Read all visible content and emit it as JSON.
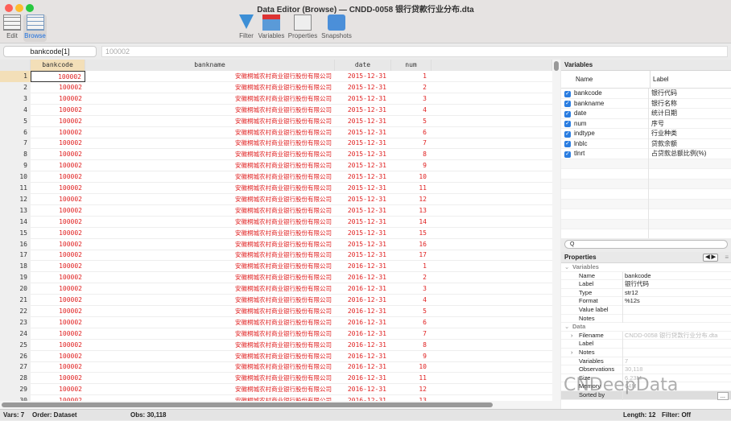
{
  "window": {
    "title": "Data Editor (Browse) — CNDD-0058 银行贷款行业分布.dta"
  },
  "toolbar": {
    "edit": "Edit",
    "browse": "Browse",
    "filter": "Filter",
    "variables": "Variables",
    "properties": "Properties",
    "snapshots": "Snapshots"
  },
  "cellbar": {
    "name": "bankcode[1]",
    "value": "100002"
  },
  "columns": [
    "bankcode",
    "bankname",
    "date",
    "num"
  ],
  "rows": [
    [
      "1",
      "100002",
      "安徽桐城农村商业银行股份有限公司",
      "2015-12-31",
      "1"
    ],
    [
      "2",
      "100002",
      "安徽桐城农村商业银行股份有限公司",
      "2015-12-31",
      "2"
    ],
    [
      "3",
      "100002",
      "安徽桐城农村商业银行股份有限公司",
      "2015-12-31",
      "3"
    ],
    [
      "4",
      "100002",
      "安徽桐城农村商业银行股份有限公司",
      "2015-12-31",
      "4"
    ],
    [
      "5",
      "100002",
      "安徽桐城农村商业银行股份有限公司",
      "2015-12-31",
      "5"
    ],
    [
      "6",
      "100002",
      "安徽桐城农村商业银行股份有限公司",
      "2015-12-31",
      "6"
    ],
    [
      "7",
      "100002",
      "安徽桐城农村商业银行股份有限公司",
      "2015-12-31",
      "7"
    ],
    [
      "8",
      "100002",
      "安徽桐城农村商业银行股份有限公司",
      "2015-12-31",
      "8"
    ],
    [
      "9",
      "100002",
      "安徽桐城农村商业银行股份有限公司",
      "2015-12-31",
      "9"
    ],
    [
      "10",
      "100002",
      "安徽桐城农村商业银行股份有限公司",
      "2015-12-31",
      "10"
    ],
    [
      "11",
      "100002",
      "安徽桐城农村商业银行股份有限公司",
      "2015-12-31",
      "11"
    ],
    [
      "12",
      "100002",
      "安徽桐城农村商业银行股份有限公司",
      "2015-12-31",
      "12"
    ],
    [
      "13",
      "100002",
      "安徽桐城农村商业银行股份有限公司",
      "2015-12-31",
      "13"
    ],
    [
      "14",
      "100002",
      "安徽桐城农村商业银行股份有限公司",
      "2015-12-31",
      "14"
    ],
    [
      "15",
      "100002",
      "安徽桐城农村商业银行股份有限公司",
      "2015-12-31",
      "15"
    ],
    [
      "16",
      "100002",
      "安徽桐城农村商业银行股份有限公司",
      "2015-12-31",
      "16"
    ],
    [
      "17",
      "100002",
      "安徽桐城农村商业银行股份有限公司",
      "2015-12-31",
      "17"
    ],
    [
      "18",
      "100002",
      "安徽桐城农村商业银行股份有限公司",
      "2016-12-31",
      "1"
    ],
    [
      "19",
      "100002",
      "安徽桐城农村商业银行股份有限公司",
      "2016-12-31",
      "2"
    ],
    [
      "20",
      "100002",
      "安徽桐城农村商业银行股份有限公司",
      "2016-12-31",
      "3"
    ],
    [
      "21",
      "100002",
      "安徽桐城农村商业银行股份有限公司",
      "2016-12-31",
      "4"
    ],
    [
      "22",
      "100002",
      "安徽桐城农村商业银行股份有限公司",
      "2016-12-31",
      "5"
    ],
    [
      "23",
      "100002",
      "安徽桐城农村商业银行股份有限公司",
      "2016-12-31",
      "6"
    ],
    [
      "24",
      "100002",
      "安徽桐城农村商业银行股份有限公司",
      "2016-12-31",
      "7"
    ],
    [
      "25",
      "100002",
      "安徽桐城农村商业银行股份有限公司",
      "2016-12-31",
      "8"
    ],
    [
      "26",
      "100002",
      "安徽桐城农村商业银行股份有限公司",
      "2016-12-31",
      "9"
    ],
    [
      "27",
      "100002",
      "安徽桐城农村商业银行股份有限公司",
      "2016-12-31",
      "10"
    ],
    [
      "28",
      "100002",
      "安徽桐城农村商业银行股份有限公司",
      "2016-12-31",
      "11"
    ],
    [
      "29",
      "100002",
      "安徽桐城农村商业银行股份有限公司",
      "2016-12-31",
      "12"
    ],
    [
      "30",
      "100002",
      "安徽桐城农村商业银行股份有限公司",
      "2016-12-31",
      "13"
    ]
  ],
  "variables_panel": {
    "title": "Variables",
    "col_name": "Name",
    "col_label": "Label",
    "items": [
      {
        "name": "bankcode",
        "label": "银行代码"
      },
      {
        "name": "bankname",
        "label": "银行名称"
      },
      {
        "name": "date",
        "label": "统计日期"
      },
      {
        "name": "num",
        "label": "序号"
      },
      {
        "name": "indtype",
        "label": "行业种类"
      },
      {
        "name": "lnblc",
        "label": "贷款余额"
      },
      {
        "name": "tlnrt",
        "label": "占贷款总额比例(%)"
      }
    ],
    "search_placeholder": "Q"
  },
  "properties_panel": {
    "title": "Properties",
    "variables_section": "Variables",
    "data_section": "Data",
    "rows": [
      {
        "k": "Name",
        "v": "bankcode",
        "sec": "v"
      },
      {
        "k": "Label",
        "v": "银行代码",
        "sec": "v"
      },
      {
        "k": "Type",
        "v": "str12",
        "sec": "v"
      },
      {
        "k": "Format",
        "v": "%12s",
        "sec": "v"
      },
      {
        "k": "Value label",
        "v": "",
        "sec": "v"
      },
      {
        "k": "Notes",
        "v": "",
        "sec": "v"
      },
      {
        "k": "Filename",
        "v": "CNDD-0058 银行贷款行业分布.dta",
        "sec": "d",
        "exp": true
      },
      {
        "k": "Label",
        "v": "",
        "sec": "d"
      },
      {
        "k": "Notes",
        "v": "",
        "sec": "d",
        "exp": true
      },
      {
        "k": "Variables",
        "v": "7",
        "sec": "d"
      },
      {
        "k": "Observations",
        "v": "30,118",
        "sec": "d"
      },
      {
        "k": "Size",
        "v": "6.23M",
        "sec": "d"
      },
      {
        "k": "Memory",
        "v": "64M",
        "sec": "d"
      },
      {
        "k": "Sorted by",
        "v": "",
        "sec": "d"
      }
    ],
    "more_button": "..."
  },
  "watermark": "CNDeepData",
  "status": {
    "vars": "Vars: 7",
    "order": "Order: Dataset",
    "obs": "Obs: 30,118",
    "length": "Length: 12",
    "filter": "Filter: Off"
  }
}
